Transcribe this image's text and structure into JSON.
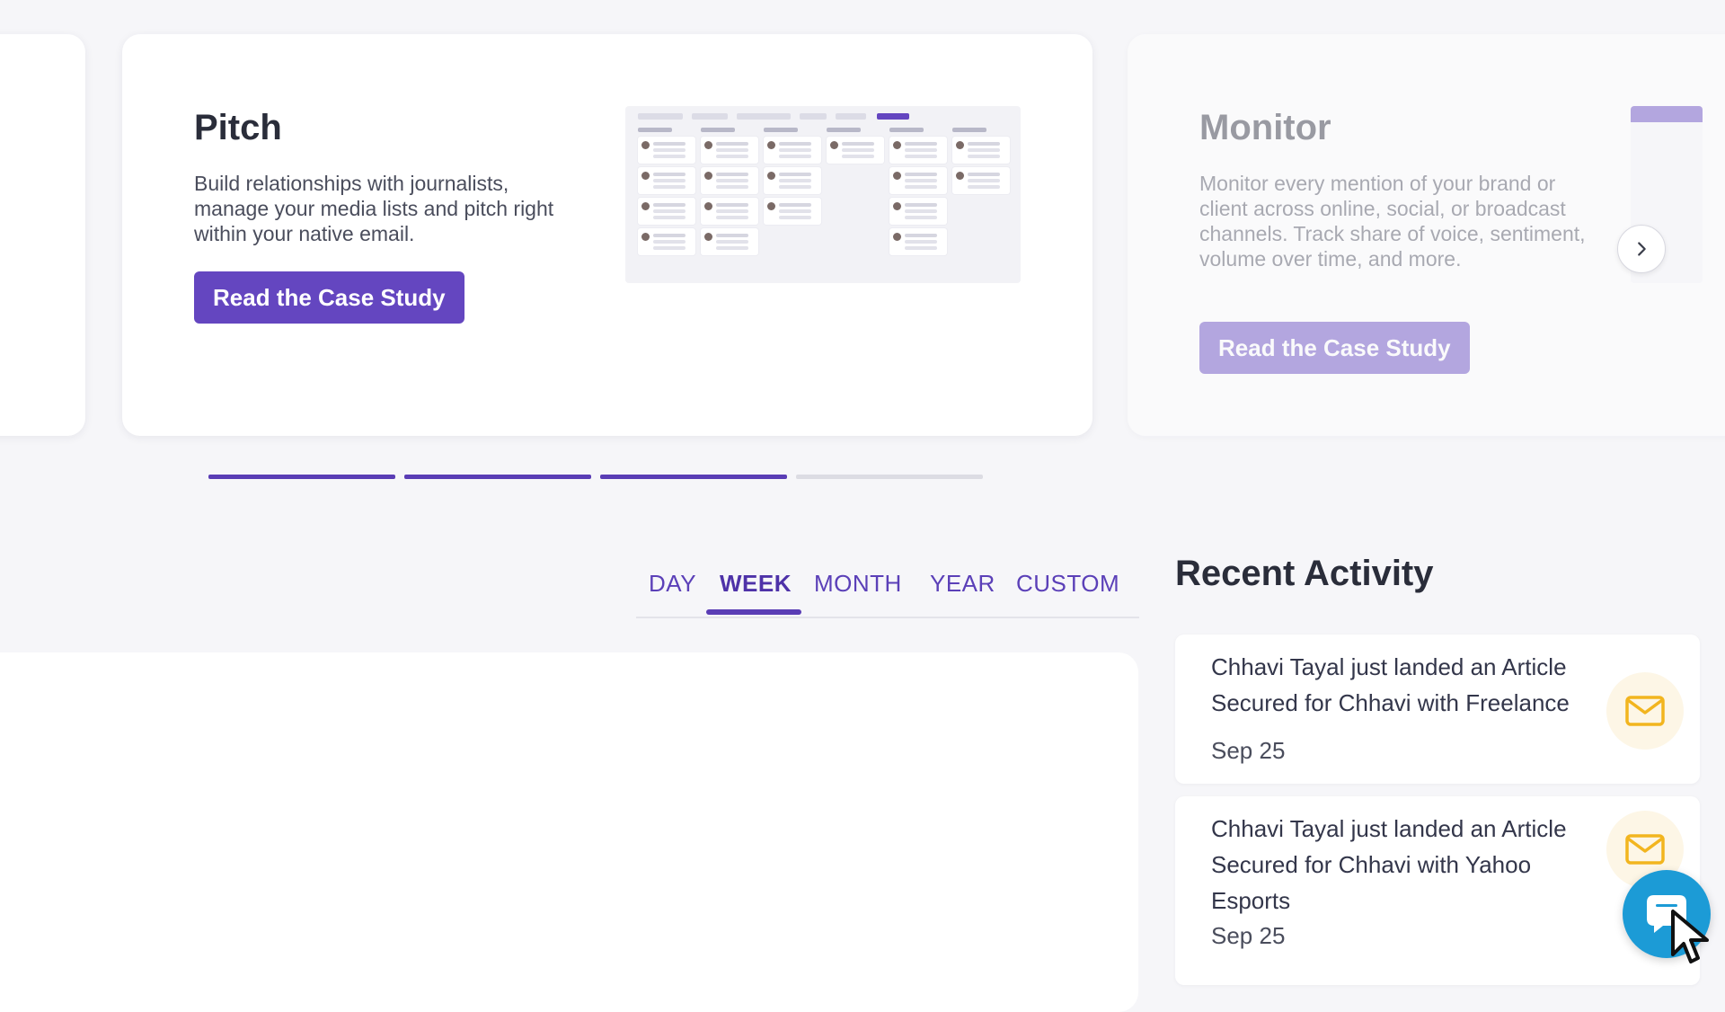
{
  "carousel": {
    "slides": [
      {
        "title": "Pitch",
        "description": "Build relationships with journalists, manage your media lists and pitch right within your native email.",
        "cta_label": "Read the Case Study"
      },
      {
        "title": "Monitor",
        "description": "Monitor every mention of your brand or client across online, social, or broadcast channels. Track share of voice, sentiment, volume over time, and more.",
        "cta_label": "Read the Case Study"
      }
    ],
    "progress": {
      "total": 4,
      "active": 3
    },
    "next_icon": "chevron-right-icon"
  },
  "time_filter": {
    "tabs": [
      "DAY",
      "WEEK",
      "MONTH",
      "YEAR",
      "CUSTOM"
    ],
    "active_tab": "WEEK"
  },
  "recent_activity": {
    "title": "Recent Activity",
    "items": [
      {
        "text": "Chhavi Tayal just landed an Article Secured for Chhavi with Freelance",
        "date": "Sep 25",
        "icon": "mail-icon"
      },
      {
        "text": "Chhavi Tayal just landed an Article Secured for Chhavi with Yahoo Esports",
        "date": "Sep 25",
        "icon": "mail-icon"
      }
    ]
  },
  "colors": {
    "brand_purple": "#6446c0",
    "activity_icon": "#f2b51f",
    "chat_launcher": "#1c9bd6"
  },
  "chat": {
    "icon": "chat-bubble-icon"
  }
}
